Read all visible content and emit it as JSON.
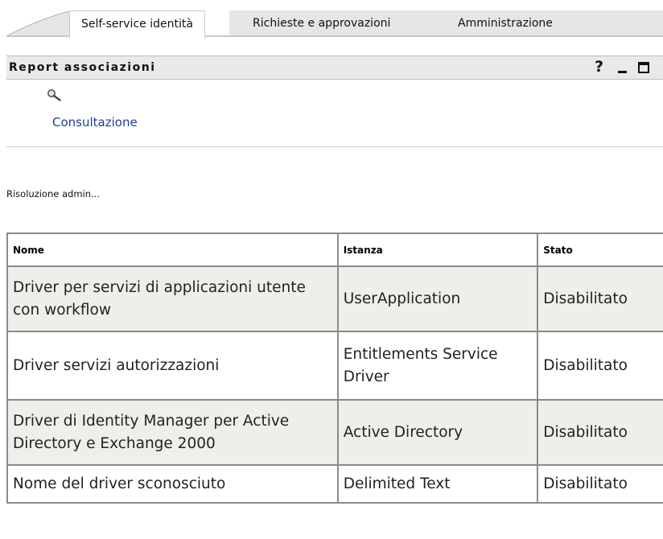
{
  "tabs": [
    {
      "label": "Self-service identità",
      "active": true
    },
    {
      "label": "Richieste e approvazioni",
      "active": false
    },
    {
      "label": "Amministrazione",
      "active": false
    }
  ],
  "portlet": {
    "title": "Report associazioni",
    "help": "?",
    "minimize_icon": "minimize-icon",
    "maximize_icon": "maximize-icon"
  },
  "search": {
    "icon": "magnifier-icon",
    "label": "Consultazione"
  },
  "status_text": "Risoluzione admin...",
  "table": {
    "columns": [
      "Nome",
      "Istanza",
      "Stato"
    ],
    "rows": [
      {
        "name": "Driver per servizi di applicazioni utente con workflow",
        "instance": "UserApplication",
        "state": "Disabilitato"
      },
      {
        "name": "Driver servizi autorizzazioni",
        "instance": "Entitlements Service Driver",
        "state": "Disabilitato"
      },
      {
        "name": "Driver di Identity Manager per Active Directory e Exchange 2000",
        "instance": "Active Directory",
        "state": "Disabilitato"
      },
      {
        "name": "Nome del driver sconosciuto",
        "instance": "Delimited Text",
        "state": "Disabilitato"
      }
    ]
  },
  "colors": {
    "link": "#1b3f95",
    "header_bg": "#e9e9e9",
    "row_shade": "#efeeea",
    "border": "#8a8a8a"
  }
}
